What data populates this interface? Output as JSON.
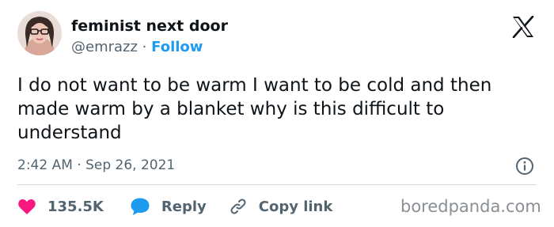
{
  "author": {
    "name": "feminist next door",
    "handle": "@emrazz",
    "separator": "·",
    "follow_label": "Follow"
  },
  "tweet": {
    "text": "I do not want to be warm I want to be cold and then made warm by a blanket why is this difficult to understand",
    "timestamp": "2:42 AM · Sep 26, 2021"
  },
  "actions": {
    "like_count": "135.5K",
    "reply_label": "Reply",
    "copy_link_label": "Copy link"
  },
  "watermark": "boredpanda.com",
  "icons": {
    "brand": "x-logo-icon",
    "like": "heart-icon",
    "reply": "speech-bubble-icon",
    "copy": "link-icon",
    "info": "info-icon"
  },
  "colors": {
    "text": "#0f1419",
    "secondary": "#536471",
    "link": "#1d9bf0",
    "like": "#f91880",
    "reply": "#1d9bf0",
    "divider": "#cfd9de"
  }
}
